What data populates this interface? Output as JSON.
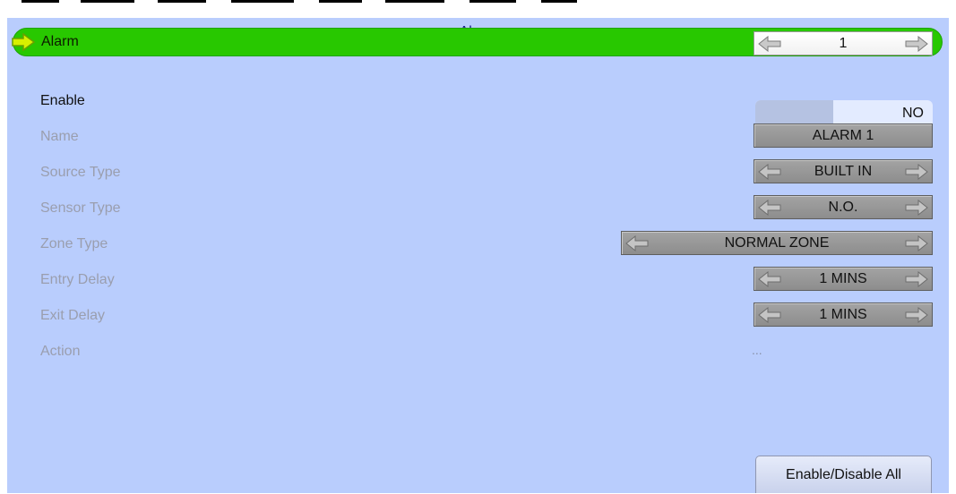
{
  "title": "Alarm",
  "selected_row": {
    "label": "Alarm",
    "value": "1"
  },
  "enable": {
    "label": "Enable",
    "value": "NO"
  },
  "rows": {
    "name": {
      "label": "Name",
      "value": "ALARM 1"
    },
    "source_type": {
      "label": "Source Type",
      "value": "BUILT IN"
    },
    "sensor_type": {
      "label": "Sensor Type",
      "value": "N.O."
    },
    "zone_type": {
      "label": "Zone Type",
      "value": "NORMAL ZONE"
    },
    "entry_delay": {
      "label": "Entry Delay",
      "value": "1 MINS"
    },
    "exit_delay": {
      "label": "Exit Delay",
      "value": "1 MINS"
    },
    "action": {
      "label": "Action",
      "value": "..."
    }
  },
  "enable_disable_all_label": "Enable/Disable All",
  "colors": {
    "panel_bg": "#b9cdfd",
    "highlight": "#28c800",
    "title": "#1a1f8a",
    "disabled_text": "#9a9eae"
  },
  "icons": {
    "row_pointer": "green-right-arrow-icon",
    "spinner_left": "left-arrow-icon",
    "spinner_right": "right-arrow-icon"
  }
}
